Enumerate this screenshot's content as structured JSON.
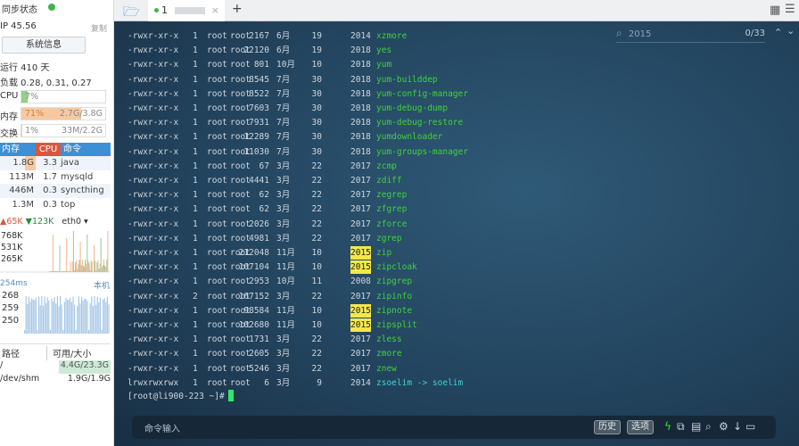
{
  "sidebar": {
    "sync_label": "同步状态",
    "sync_color": "#3cb54a",
    "ip": "IP 45.56",
    "copy": "复制",
    "sysinfo_button": "系统信息",
    "uptime": "运行 410 天",
    "load": "负载 0.28, 0.31, 0.27",
    "cpu_label": "CPU",
    "cpu_value": "7%",
    "cpu_percent": 7,
    "mem_label": "内存",
    "mem_value": "71%",
    "mem_size": "2.7G/3.8G",
    "mem_percent": 71,
    "swap_label": "交换",
    "swap_value": "1%",
    "swap_size": "33M/2.2G",
    "swap_percent": 1,
    "proc_headers": [
      "内存",
      "CPU",
      "命令"
    ],
    "procs": [
      [
        "1.8G",
        "3.3",
        "java"
      ],
      [
        "113M",
        "1.7",
        "mysqld"
      ],
      [
        "446M",
        "0.3",
        "syncthing"
      ],
      [
        "1.3M",
        "0.3",
        "top"
      ]
    ],
    "net_up": "65K",
    "net_down": "123K",
    "net_iface": "eth0",
    "net_ticks": [
      "768K",
      "531K",
      "265K"
    ],
    "ping": "254ms",
    "ping_host": "本机",
    "ping_ticks": [
      "268",
      "259",
      "250"
    ],
    "disk_headers": [
      "路径",
      "可用/大小"
    ],
    "disks": [
      [
        "/",
        "4.4G/23.3G"
      ],
      [
        "/dev/shm",
        "1.9G/1.9G"
      ]
    ]
  },
  "tabs": {
    "items": [
      {
        "label": "1"
      }
    ],
    "add": "+"
  },
  "search": {
    "query": "2015",
    "count": "0/33"
  },
  "terminal": {
    "rows": [
      [
        "-rwxr-xr-x",
        "1",
        "root",
        "root",
        "2167",
        "6月",
        "19",
        "2014",
        "xzmore"
      ],
      [
        "-rwxr-xr-x",
        "1",
        "root",
        "root",
        "22120",
        "6月",
        "19",
        "2018",
        "yes"
      ],
      [
        "-rwxr-xr-x",
        "1",
        "root",
        "root",
        "801",
        "10月",
        "10",
        "2018",
        "yum"
      ],
      [
        "-rwxr-xr-x",
        "1",
        "root",
        "root",
        "8545",
        "7月",
        "30",
        "2018",
        "yum-builddep"
      ],
      [
        "-rwxr-xr-x",
        "1",
        "root",
        "root",
        "8522",
        "7月",
        "30",
        "2018",
        "yum-config-manager"
      ],
      [
        "-rwxr-xr-x",
        "1",
        "root",
        "root",
        "7603",
        "7月",
        "30",
        "2018",
        "yum-debug-dump"
      ],
      [
        "-rwxr-xr-x",
        "1",
        "root",
        "root",
        "7931",
        "7月",
        "30",
        "2018",
        "yum-debug-restore"
      ],
      [
        "-rwxr-xr-x",
        "1",
        "root",
        "root",
        "12289",
        "7月",
        "30",
        "2018",
        "yumdownloader"
      ],
      [
        "-rwxr-xr-x",
        "1",
        "root",
        "root",
        "11030",
        "7月",
        "30",
        "2018",
        "yum-groups-manager"
      ],
      [
        "-rwxr-xr-x",
        "1",
        "root",
        "root",
        "67",
        "3月",
        "22",
        "2017",
        "zcmp"
      ],
      [
        "-rwxr-xr-x",
        "1",
        "root",
        "root",
        "4441",
        "3月",
        "22",
        "2017",
        "zdiff"
      ],
      [
        "-rwxr-xr-x",
        "1",
        "root",
        "root",
        "62",
        "3月",
        "22",
        "2017",
        "zegrep"
      ],
      [
        "-rwxr-xr-x",
        "1",
        "root",
        "root",
        "62",
        "3月",
        "22",
        "2017",
        "zfgrep"
      ],
      [
        "-rwxr-xr-x",
        "1",
        "root",
        "root",
        "2026",
        "3月",
        "22",
        "2017",
        "zforce"
      ],
      [
        "-rwxr-xr-x",
        "1",
        "root",
        "root",
        "4981",
        "3月",
        "22",
        "2017",
        "zgrep"
      ],
      [
        "-rwxr-xr-x",
        "1",
        "root",
        "root",
        "212048",
        "11月",
        "10",
        "2015",
        "zip"
      ],
      [
        "-rwxr-xr-x",
        "1",
        "root",
        "root",
        "107104",
        "11月",
        "10",
        "2015",
        "zipcloak"
      ],
      [
        "-rwxr-xr-x",
        "1",
        "root",
        "root",
        "2953",
        "10月",
        "11",
        "2008",
        "zipgrep"
      ],
      [
        "-rwxr-xr-x",
        "2",
        "root",
        "root",
        "167152",
        "3月",
        "22",
        "2017",
        "zipinfo"
      ],
      [
        "-rwxr-xr-x",
        "1",
        "root",
        "root",
        "98584",
        "11月",
        "10",
        "2015",
        "zipnote"
      ],
      [
        "-rwxr-xr-x",
        "1",
        "root",
        "root",
        "102680",
        "11月",
        "10",
        "2015",
        "zipsplit"
      ],
      [
        "-rwxr-xr-x",
        "1",
        "root",
        "root",
        "1731",
        "3月",
        "22",
        "2017",
        "zless"
      ],
      [
        "-rwxr-xr-x",
        "1",
        "root",
        "root",
        "2605",
        "3月",
        "22",
        "2017",
        "zmore"
      ],
      [
        "-rwxr-xr-x",
        "1",
        "root",
        "root",
        "5246",
        "3月",
        "22",
        "2017",
        "znew"
      ],
      [
        "lrwxrwxrwx",
        "1",
        "root",
        "root",
        "6",
        "3月",
        "9",
        "2014",
        "zsoelim -> soelim"
      ]
    ],
    "prompt": "[root@li900-223 ~]#"
  },
  "cmdbar": {
    "placeholder": "命令输入",
    "history": "历史",
    "options": "选项"
  }
}
